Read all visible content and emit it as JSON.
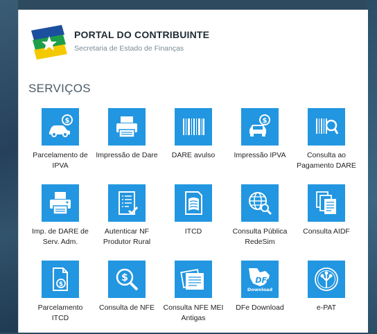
{
  "header": {
    "title": "PORTAL DO CONTRIBUINTE",
    "subtitle": "Secretaria de Estado de Finanças"
  },
  "section": {
    "title": "SERVIÇOS"
  },
  "services": [
    {
      "label": "Parcelamento de IPVA",
      "icon": "car-dollar-icon"
    },
    {
      "label": "Impressão de Dare",
      "icon": "printer-icon"
    },
    {
      "label": "DARE avulso",
      "icon": "barcode-icon"
    },
    {
      "label": "Impressão IPVA",
      "icon": "car-dollar-icon"
    },
    {
      "label": "Consulta ao Pagamento DARE",
      "icon": "barcode-search-icon"
    },
    {
      "label": "Imp. de DARE de Serv. Adm.",
      "icon": "printer-document-icon"
    },
    {
      "label": "Autenticar NF Produtor Rural",
      "icon": "checklist-icon"
    },
    {
      "label": "ITCD",
      "icon": "document-map-icon"
    },
    {
      "label": "Consulta Pública RedeSim",
      "icon": "globe-search-icon"
    },
    {
      "label": "Consulta AIDF",
      "icon": "documents-stack-icon"
    },
    {
      "label": "Parcelamento ITCD",
      "icon": "document-dollar-icon"
    },
    {
      "label": "Consulta de NFE",
      "icon": "magnifier-dollar-icon"
    },
    {
      "label": "Consulta NFE MEI Antigas",
      "icon": "receipts-icon"
    },
    {
      "label": "DFe Download",
      "icon": "dfe-download-icon",
      "icon_text": "DFe",
      "icon_sub": "Download"
    },
    {
      "label": "e-PAT",
      "icon": "tree-seal-icon"
    }
  ],
  "colors": {
    "accent": "#2296e0",
    "logo_blue": "#1c4f9e",
    "logo_green": "#1e9e4a",
    "logo_yellow": "#f4c900"
  }
}
